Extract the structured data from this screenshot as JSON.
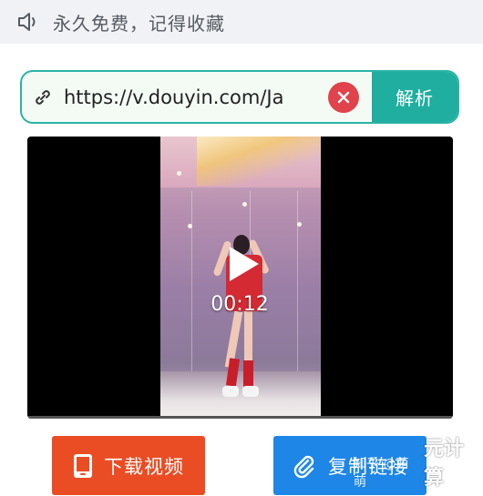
{
  "notice": {
    "icon": "speaker-icon",
    "text": "永久免费，记得收藏"
  },
  "url_bar": {
    "icon": "link-icon",
    "value": "https://v.douyin.com/Ja",
    "clear_icon": "close-icon",
    "parse_label": "解析"
  },
  "player": {
    "play_icon": "play-icon",
    "duration": "00:12"
  },
  "actions": {
    "download_label": "下载视频",
    "download_icon": "tablet-icon",
    "copy_label": "复制链接",
    "copy_icon": "paperclip-icon"
  },
  "watermark": {
    "small": "知乎 @萌萌",
    "big": "元计算"
  },
  "colors": {
    "accent_teal": "#1fae9f",
    "clear_red": "#e0434b",
    "download_orange": "#ea4d24",
    "copy_blue": "#1e86e6"
  }
}
